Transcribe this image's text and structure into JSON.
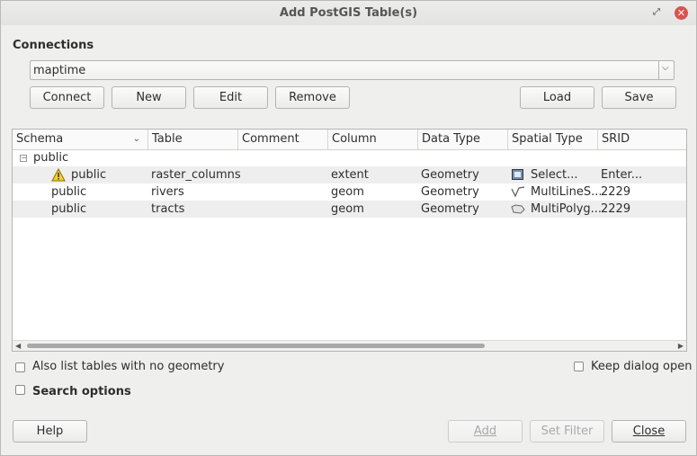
{
  "window": {
    "title": "Add PostGIS Table(s)"
  },
  "connections": {
    "label": "Connections",
    "selected": "maptime",
    "buttons": {
      "connect": "Connect",
      "new": "New",
      "edit": "Edit",
      "remove": "Remove",
      "load": "Load",
      "save": "Save"
    }
  },
  "table": {
    "columns": [
      "Schema",
      "Table",
      "Comment",
      "Column",
      "Data Type",
      "Spatial Type",
      "SRID"
    ],
    "group": "public",
    "rows": [
      {
        "schema": "public",
        "table": "raster_columns",
        "comment": "",
        "column": "extent",
        "data_type": "Geometry",
        "spatial_type": "Select...",
        "srid": "Enter...",
        "warning": true,
        "icon": "raster-icon"
      },
      {
        "schema": "public",
        "table": "rivers",
        "comment": "",
        "column": "geom",
        "data_type": "Geometry",
        "spatial_type": "MultiLineS...",
        "srid": "2229",
        "warning": false,
        "icon": "line-icon"
      },
      {
        "schema": "public",
        "table": "tracts",
        "comment": "",
        "column": "geom",
        "data_type": "Geometry",
        "spatial_type": "MultiPolyg...",
        "srid": "2229",
        "warning": false,
        "icon": "polygon-icon"
      }
    ]
  },
  "options": {
    "no_geometry": "Also list tables with no geometry",
    "keep_open": "Keep dialog open",
    "search": "Search options"
  },
  "footer": {
    "help": "Help",
    "add": "Add",
    "set_filter": "Set Filter",
    "close": "Close"
  }
}
